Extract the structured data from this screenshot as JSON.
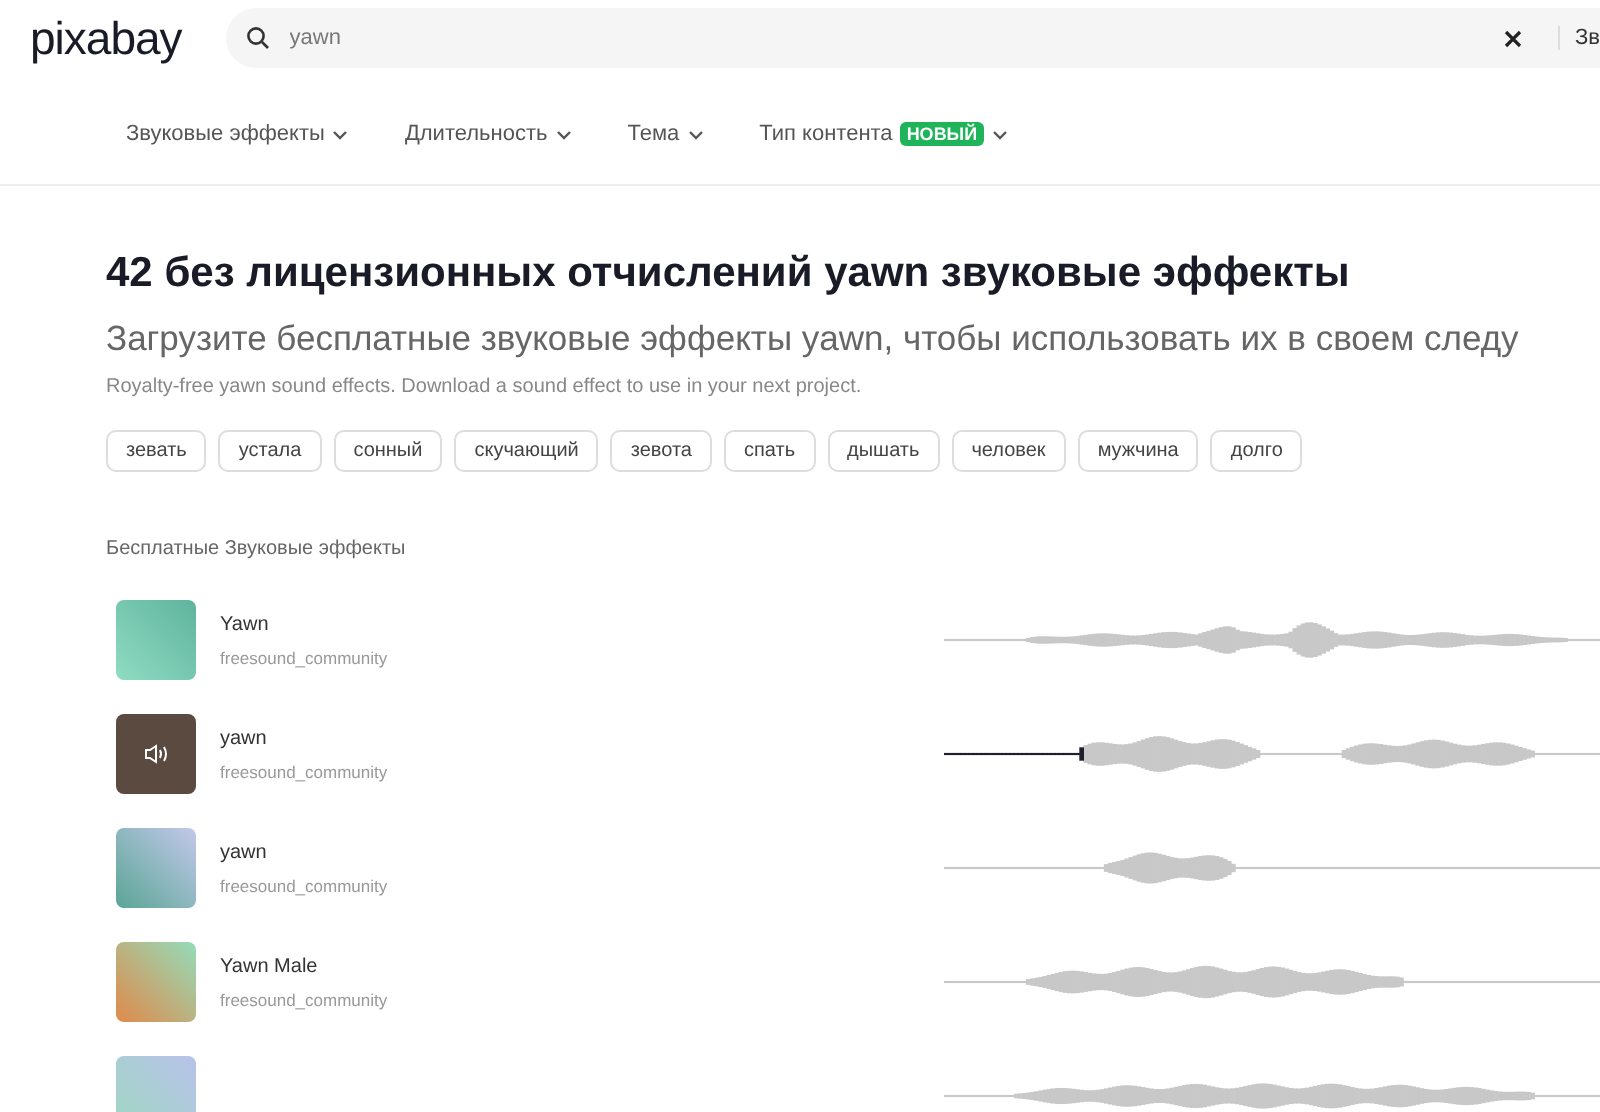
{
  "header": {
    "logo": "pixabay",
    "search": {
      "value": "yawn"
    },
    "button_cut": "Зв"
  },
  "filters": [
    {
      "label": "Звуковые эффекты"
    },
    {
      "label": "Длительность"
    },
    {
      "label": "Тема"
    },
    {
      "label": "Тип контента",
      "badge": "НОВЫЙ"
    }
  ],
  "title": "42 без лицензионных отчислений yawn звуковые эффекты",
  "subtitle": "Загрузите бесплатные звуковые эффекты yawn, чтобы использовать их в своем следу",
  "description": "Royalty-free yawn sound effects. Download a sound effect to use in your next project.",
  "tags": [
    "зевать",
    "устала",
    "сонный",
    "скучающий",
    "зевота",
    "спать",
    "дышать",
    "человек",
    "мужчина",
    "долго"
  ],
  "section_label": "Бесплатные Звуковые эффекты",
  "tracks": [
    {
      "title": "Yawn",
      "author": "freesound_community",
      "playing": false
    },
    {
      "title": "yawn",
      "author": "freesound_community",
      "playing": true,
      "level": 0.21
    },
    {
      "title": "yawn",
      "author": "freesound_community",
      "playing": false
    },
    {
      "title": "Yawn Male",
      "author": "freesound_community",
      "playing": false
    },
    {
      "playing": false
    }
  ]
}
